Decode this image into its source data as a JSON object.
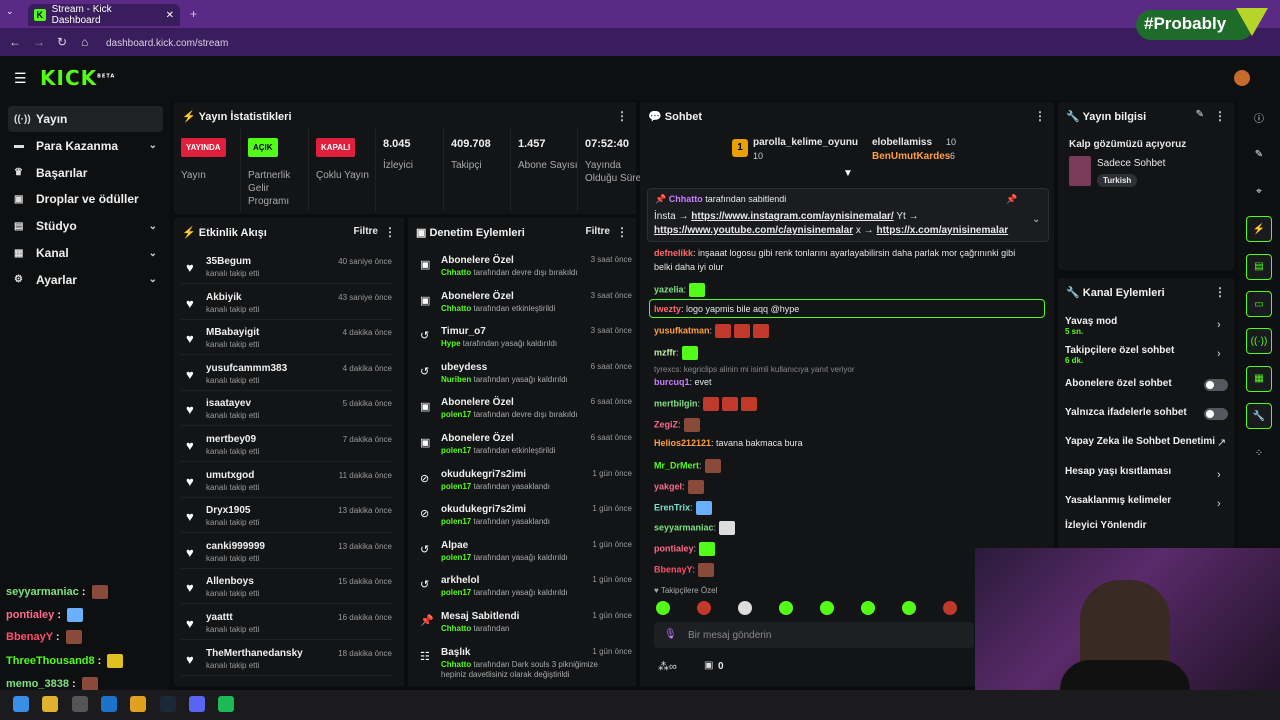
{
  "browser": {
    "tab_title": "Stream - Kick Dashboard",
    "url": "dashboard.kick.com/stream",
    "watermark": "#Probably"
  },
  "topbar": {
    "logo": "KICK",
    "logo_sup": "BETA"
  },
  "sidebar": {
    "items": [
      {
        "label": "Yayın",
        "icon": "broadcast-icon",
        "chevron": false
      },
      {
        "label": "Para Kazanma",
        "icon": "money-icon",
        "chevron": true
      },
      {
        "label": "Başarılar",
        "icon": "trophy-icon",
        "chevron": false
      },
      {
        "label": "Droplar ve ödüller",
        "icon": "gift-icon",
        "chevron": false
      },
      {
        "label": "Stüdyo",
        "icon": "studio-icon",
        "chevron": true
      },
      {
        "label": "Kanal",
        "icon": "channel-icon",
        "chevron": true
      },
      {
        "label": "Ayarlar",
        "icon": "gear-icon",
        "chevron": true
      }
    ]
  },
  "stats": {
    "title": "Yayın İstatistikleri",
    "items": [
      {
        "badge": "YAYINDA",
        "label": "Yayın"
      },
      {
        "badge": "AÇIK",
        "label": "Partnerlik Gelir Programı"
      },
      {
        "badge": "KAPALI",
        "label": "Çoklu Yayın"
      },
      {
        "value": "8.045",
        "label": "İzleyici"
      },
      {
        "value": "409.708",
        "label": "Takipçi"
      },
      {
        "value": "1.457",
        "label": "Abone Sayısı"
      },
      {
        "value": "07:52:40",
        "label": "Yayında Olduğu Süre"
      }
    ]
  },
  "activity": {
    "title": "Etkinlik Akışı",
    "filter": "Filtre",
    "rows": [
      {
        "name": "35Begum",
        "sub": "kanalı takip etti",
        "time": "40 saniye önce"
      },
      {
        "name": "Akbiyik",
        "sub": "kanalı takip etti",
        "time": "43 saniye önce"
      },
      {
        "name": "MBabayigit",
        "sub": "kanalı takip etti",
        "time": "4 dakika önce"
      },
      {
        "name": "yusufcammm383",
        "sub": "kanalı takip etti",
        "time": "4 dakika önce"
      },
      {
        "name": "isaatayev",
        "sub": "kanalı takip etti",
        "time": "5 dakika önce"
      },
      {
        "name": "mertbey09",
        "sub": "kanalı takip etti",
        "time": "7 dakika önce"
      },
      {
        "name": "umutxgod",
        "sub": "kanalı takip etti",
        "time": "11 dakika önce"
      },
      {
        "name": "Dryx1905",
        "sub": "kanalı takip etti",
        "time": "13 dakika önce"
      },
      {
        "name": "canki999999",
        "sub": "kanalı takip etti",
        "time": "13 dakika önce"
      },
      {
        "name": "Allenboys",
        "sub": "kanalı takip etti",
        "time": "15 dakika önce"
      },
      {
        "name": "yaattt",
        "sub": "kanalı takip etti",
        "time": "16 dakika önce"
      },
      {
        "name": "TheMerthanedansky",
        "sub": "kanalı takip etti",
        "time": "18 dakika önce"
      }
    ]
  },
  "moderation": {
    "title": "Denetim Eylemleri",
    "filter": "Filtre",
    "rows": [
      {
        "icon": "gift-icon",
        "name": "Abonelere Özel",
        "who": "Chhatto",
        "sub": "tarafından devre dışı bırakıldı",
        "time": "3 saat önce"
      },
      {
        "icon": "gift-icon",
        "name": "Abonelere Özel",
        "who": "Chhatto",
        "sub": "tarafından etkinleştirildi",
        "time": "3 saat önce"
      },
      {
        "icon": "undo-icon",
        "name": "Timur_o7",
        "who": "Hype",
        "sub": "tarafından yasağı kaldırıldı",
        "time": "3 saat önce"
      },
      {
        "icon": "undo-icon",
        "name": "ubeydess",
        "who": "Nuriben",
        "sub": "tarafından yasağı kaldırıldı",
        "time": "6 saat önce"
      },
      {
        "icon": "gift-icon",
        "name": "Abonelere Özel",
        "who": "polen17",
        "sub": "tarafından devre dışı bırakıldı",
        "time": "6 saat önce"
      },
      {
        "icon": "gift-icon",
        "name": "Abonelere Özel",
        "who": "polen17",
        "sub": "tarafından etkinleştirildi",
        "time": "6 saat önce"
      },
      {
        "icon": "ban-icon",
        "name": "okudukegri7s2imi",
        "who": "polen17",
        "sub": "tarafından yasaklandı",
        "time": "1 gün önce"
      },
      {
        "icon": "ban-icon",
        "name": "okudukegri7s2imi",
        "who": "polen17",
        "sub": "tarafından yasaklandı",
        "time": "1 gün önce"
      },
      {
        "icon": "undo-icon",
        "name": "Alpae",
        "who": "polen17",
        "sub": "tarafından yasağı kaldırıldı",
        "time": "1 gün önce"
      },
      {
        "icon": "undo-icon",
        "name": "arkhelol",
        "who": "polen17",
        "sub": "tarafından yasağı kaldırıldı",
        "time": "1 gün önce"
      },
      {
        "icon": "pin-icon",
        "name": "Mesaj Sabitlendi",
        "who": "Chhatto",
        "sub": "tarafından",
        "time": "1 gün önce"
      },
      {
        "icon": "title-icon",
        "name": "Başlık",
        "who": "Chhatto",
        "sub": "tarafından Dark souls 3 pikniğimize hepiniz davetlisiniz olarak değiştirildi",
        "time": "1 gün önce"
      }
    ]
  },
  "chat": {
    "title": "Sohbet",
    "leaders": [
      {
        "rank": "1",
        "name": "parolla_kelime_oyunu",
        "count": "10"
      },
      {
        "name": "elobellamiss",
        "count": "10"
      },
      {
        "name": "BenUmutKardes",
        "count": "6"
      }
    ],
    "pinned": {
      "by": "Chhatto",
      "by_suffix": "tarafından sabitlendi",
      "line1_prefix": "İnsta →",
      "line1_link": "https://www.instagram.com/aynisinemalar/",
      "line1_suffix": "Yt →",
      "line2_link": "https://www.youtube.com/c/aynisinemalar",
      "line2_mid": "x →",
      "line2_link2": "https://x.com/aynisinemalar"
    },
    "messages": [
      {
        "user": "defnelikk",
        "color": "#ff6b6b",
        "text": ": inşaaat logosu gibi renk tonlarını ayarlayabilirsin daha parlak mor çağrınınki gibi"
      },
      {
        "user": "",
        "color": "#e6e6e6",
        "text": "belki daha iyi olur"
      },
      {
        "user": "yazelia",
        "color": "#7ee081",
        "text": ":"
      },
      {
        "user": "lwezty",
        "color": "#ff6b6b",
        "text": ": logo yapmis bile aqq @hype"
      },
      {
        "user": "yusufkatman",
        "color": "#ff9f43",
        "text": ":"
      },
      {
        "user": "mzffr",
        "color": "#c3f0a8",
        "text": ":"
      },
      {
        "user": "tyrexcs: kegriclips alinin mi isimli kullanıcıya yanıt veriyor",
        "color": "#8a8a8a",
        "text": ""
      },
      {
        "user": "burcuq1",
        "color": "#c77dff",
        "text": ": evet"
      },
      {
        "user": "mertbilgin",
        "color": "#7ee081",
        "text": ":"
      },
      {
        "user": "ZegiZ",
        "color": "#ff6b8b",
        "text": ":"
      },
      {
        "user": "Helios212121",
        "color": "#ff9f43",
        "text": ": tavana bakmaca bura"
      },
      {
        "user": "Mr_DrMert",
        "color": "#53fc18",
        "text": ":"
      },
      {
        "user": "yakgel",
        "color": "#ff6b8b",
        "text": ":"
      },
      {
        "user": "ErenTrix",
        "color": "#7ee0d4",
        "text": ":"
      },
      {
        "user": "seyyarmaniac",
        "color": "#7ee081",
        "text": ":"
      },
      {
        "user": "pontialey",
        "color": "#ff6b8b",
        "text": ":"
      },
      {
        "user": "BbenayY",
        "color": "#ff4f6e",
        "text": ":"
      }
    ],
    "followers_only": "Takipçilere Özel",
    "input_placeholder": "Bir mesaj gönderin",
    "points": "0"
  },
  "stream_info": {
    "title": "Yayın bilgisi",
    "stream_title": "Kalp gözümüzü açıyoruz",
    "category": "Sadece Sohbet",
    "tag": "Turkish"
  },
  "channel_actions": {
    "title": "Kanal Eylemleri",
    "items": [
      {
        "label": "Yavaş mod",
        "sub": "5 sn.",
        "control": "arrow"
      },
      {
        "label": "Takipçilere özel sohbet",
        "sub": "6 dk.",
        "control": "arrow"
      },
      {
        "label": "Abonelere özel sohbet",
        "sub": "",
        "control": "toggle"
      },
      {
        "label": "Yalnızca ifadelerle sohbet",
        "sub": "",
        "control": "toggle"
      },
      {
        "label": "Yapay Zeka ile Sohbet Denetimi",
        "sub": "",
        "control": "external"
      },
      {
        "label": "Hesap yaşı kısıtlaması",
        "sub": "",
        "control": "arrow"
      },
      {
        "label": "Yasaklanmış kelimeler",
        "sub": "",
        "control": "arrow"
      },
      {
        "label": "İzleyici Yönlendir",
        "sub": "",
        "control": "none"
      }
    ]
  },
  "overlay_chat": [
    {
      "user": "seyyarmaniac",
      "color": "#7ee081"
    },
    {
      "user": "pontialey",
      "color": "#ff6b8b"
    },
    {
      "user": "BbenayY",
      "color": "#ff4f6e"
    },
    {
      "user": "ThreeThousand8",
      "color": "#53fc18"
    },
    {
      "user": "memo_3838",
      "color": "#7ee081"
    }
  ],
  "colors": {
    "accent": "#53fc18",
    "live": "#e01f3d",
    "browser_purple": "#5b2a86"
  }
}
